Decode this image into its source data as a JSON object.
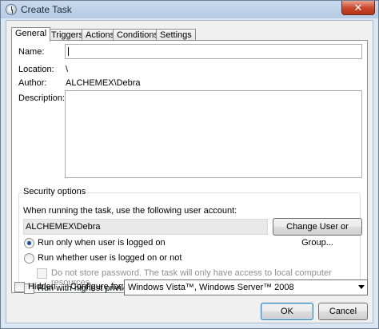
{
  "window": {
    "title": "Create Task",
    "close_glyph": "✕"
  },
  "tabs": [
    {
      "label": "General",
      "active": true
    },
    {
      "label": "Triggers",
      "active": false
    },
    {
      "label": "Actions",
      "active": false
    },
    {
      "label": "Conditions",
      "active": false
    },
    {
      "label": "Settings",
      "active": false
    }
  ],
  "general": {
    "name_label": "Name:",
    "name_value": "",
    "location_label": "Location:",
    "location_value": "\\",
    "author_label": "Author:",
    "author_value": "ALCHEMEX\\Debra",
    "description_label": "Description:",
    "description_value": ""
  },
  "security": {
    "group_title": "Security options",
    "account_prompt": "When running the task, use the following user account:",
    "account_value": "ALCHEMEX\\Debra",
    "change_user_button": "Change User or Group...",
    "radio_logged_on": "Run only when user is logged on",
    "radio_logged_on_checked": true,
    "radio_whether": "Run whether user is logged on or not",
    "radio_whether_checked": false,
    "no_store_password": "Do not store password.  The task will only have access to local computer resources.",
    "highest_privileges": "Run with highest privileges"
  },
  "footer": {
    "hidden_label": "Hidden",
    "configure_label": "Configure for:",
    "configure_value": "Windows Vista™, Windows Server™ 2008",
    "ok_button": "OK",
    "cancel_button": "Cancel"
  }
}
